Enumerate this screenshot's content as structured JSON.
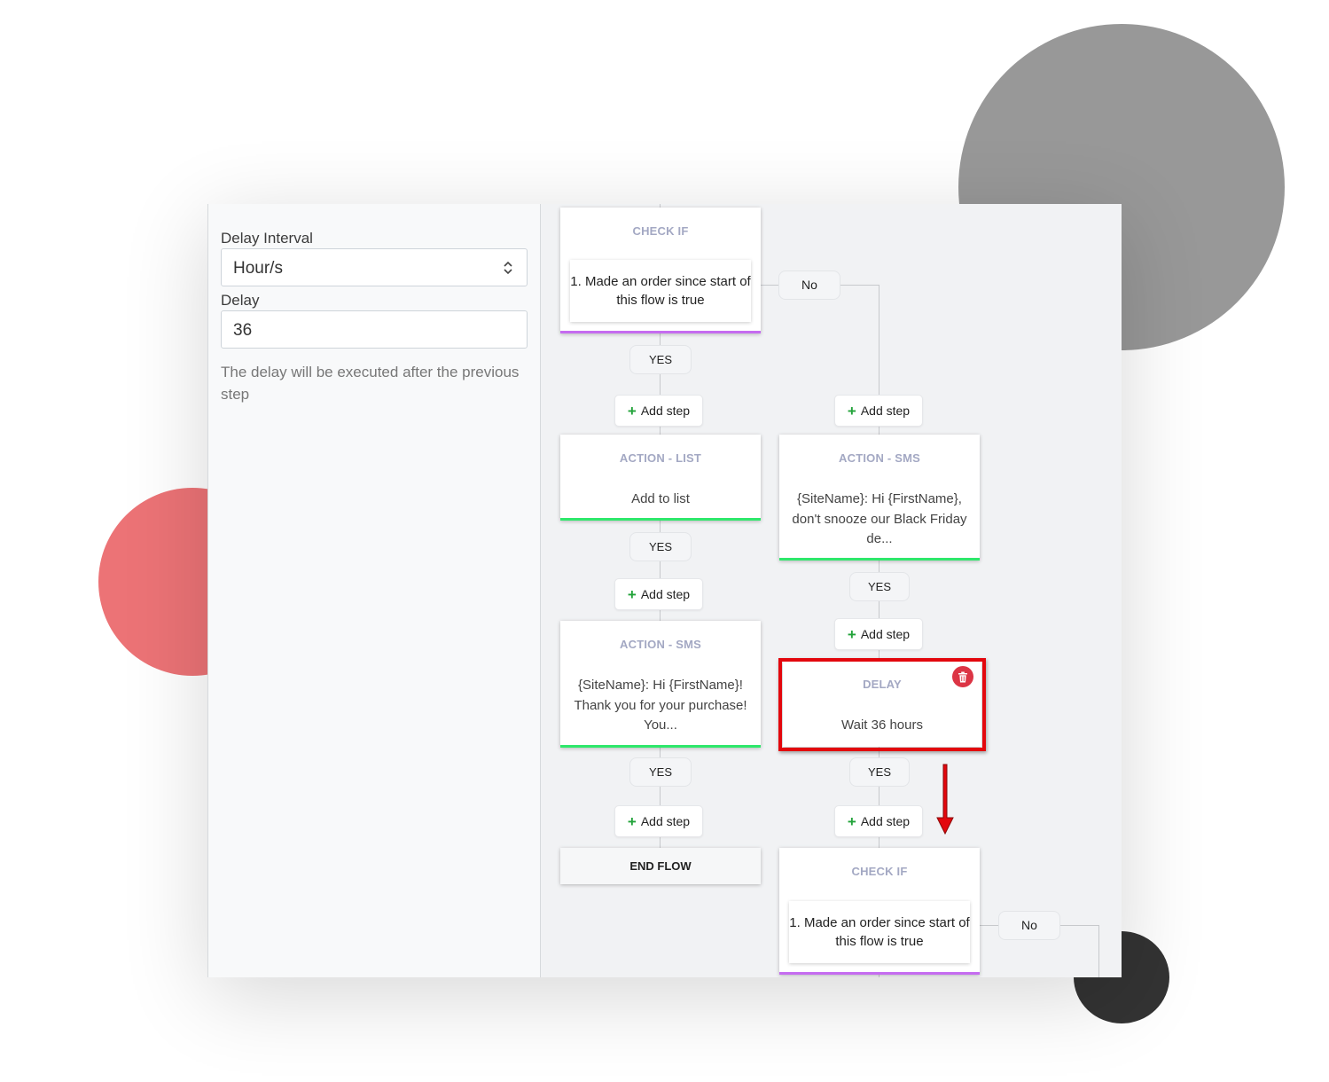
{
  "settings": {
    "delay_interval_label": "Delay Interval",
    "delay_interval_value": "Hour/s",
    "delay_label": "Delay",
    "delay_value": "36",
    "help_text": "The delay will be executed after the previous step"
  },
  "flow": {
    "node_check_if_1": {
      "type": "CHECK IF",
      "condition": "1. Made an order since start of this flow is true"
    },
    "node_action_list": {
      "type": "ACTION - LIST",
      "text": "Add to list"
    },
    "node_action_sms_left": {
      "type": "ACTION - SMS",
      "text": "{SiteName}: Hi {FirstName}! Thank you for your purchase! You..."
    },
    "node_action_sms_right": {
      "type": "ACTION - SMS",
      "text": "{SiteName}: Hi {FirstName}, don't snooze our Black Friday de..."
    },
    "node_delay": {
      "type": "DELAY",
      "text": "Wait 36 hours"
    },
    "node_check_if_2": {
      "type": "CHECK IF",
      "condition": "1. Made an order since start of this flow is true"
    },
    "end_flow_label": "END FLOW",
    "yes_label": "YES",
    "no_label": "No",
    "add_step_label": "Add step"
  },
  "icons": {
    "plus": "plus-icon",
    "trash": "trash-icon",
    "select_arrows": "sort-arrows-icon",
    "annotation_arrow": "red-down-arrow-icon"
  },
  "colors": {
    "check_if_accent": "#c56cf0",
    "action_accent": "#2ee86b",
    "add_plus": "#22a33a",
    "delete_button": "#dc3545",
    "highlight_border": "#e3070d",
    "node_type_text": "#a3a8c3"
  }
}
